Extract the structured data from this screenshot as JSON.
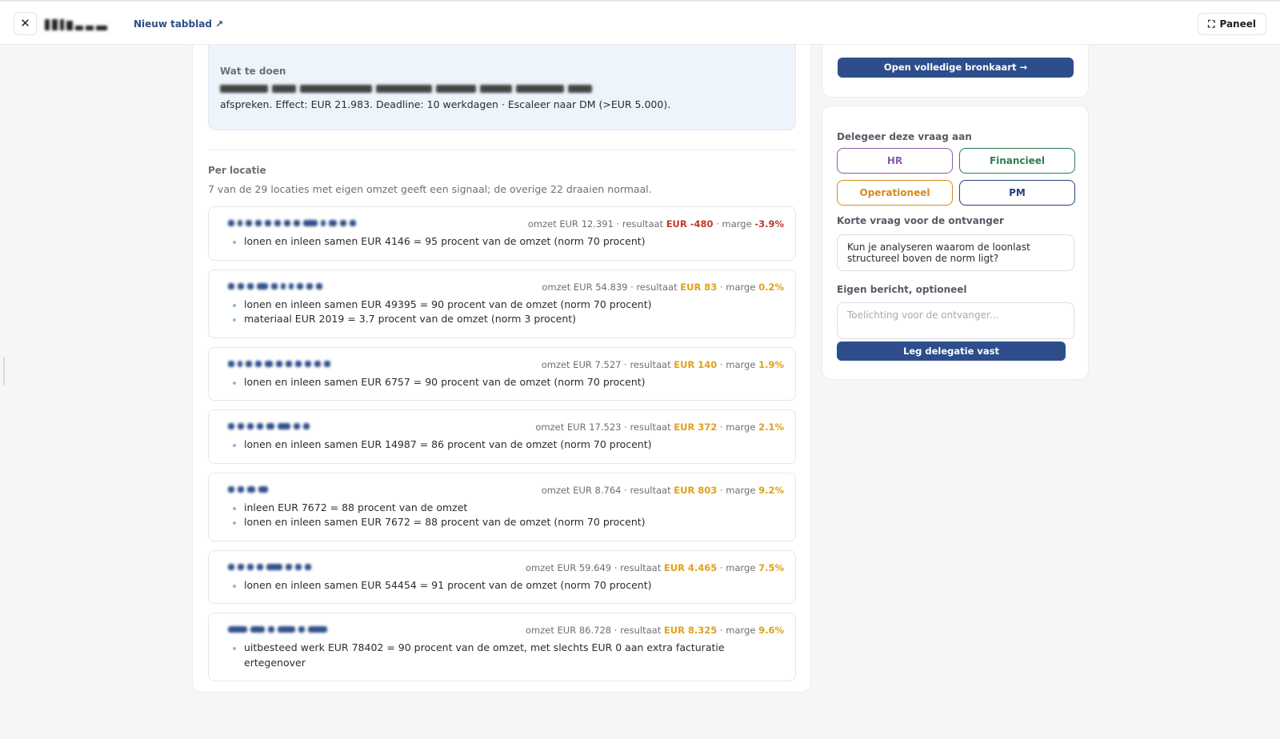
{
  "topbar": {
    "close_label": "✕",
    "new_tab_label": "Nieuw tabblad ↗",
    "panel_label": "Paneel",
    "panel_icon": "expand-icon"
  },
  "todo": {
    "heading": "Wat te doen",
    "text": "afspreken. Effect: EUR 21.983. Deadline: 10 werkdagen · Escaleer naar DM (>EUR 5.000)."
  },
  "per_locatie": {
    "heading": "Per locatie",
    "subtitle": "7 van de 29 locaties met eigen omzet geeft een signaal; de overige 22 draaien normaal.",
    "stat_labels": {
      "omzet": "omzet",
      "resultaat": "resultaat",
      "marge": "marge",
      "sep": "·"
    },
    "locations": [
      {
        "omzet": "EUR 12.391",
        "resultaat": "EUR -480",
        "marge": "-3.9%",
        "tone": "neg",
        "bullets": [
          "lonen en inleen samen EUR 4146 = 95 procent van de omzet (norm 70 procent)"
        ]
      },
      {
        "omzet": "EUR 54.839",
        "resultaat": "EUR 83",
        "marge": "0.2%",
        "tone": "pos",
        "bullets": [
          "lonen en inleen samen EUR 49395 = 90 procent van de omzet (norm 70 procent)",
          "materiaal EUR 2019 = 3.7 procent van de omzet (norm 3 procent)"
        ]
      },
      {
        "omzet": "EUR 7.527",
        "resultaat": "EUR 140",
        "marge": "1.9%",
        "tone": "pos",
        "bullets": [
          "lonen en inleen samen EUR 6757 = 90 procent van de omzet (norm 70 procent)"
        ]
      },
      {
        "omzet": "EUR 17.523",
        "resultaat": "EUR 372",
        "marge": "2.1%",
        "tone": "pos",
        "bullets": [
          "lonen en inleen samen EUR 14987 = 86 procent van de omzet (norm 70 procent)"
        ]
      },
      {
        "omzet": "EUR 8.764",
        "resultaat": "EUR 803",
        "marge": "9.2%",
        "tone": "pos",
        "bullets": [
          "inleen EUR 7672 = 88 procent van de omzet",
          "lonen en inleen samen EUR 7672 = 88 procent van de omzet (norm 70 procent)"
        ]
      },
      {
        "omzet": "EUR 59.649",
        "resultaat": "EUR 4.465",
        "marge": "7.5%",
        "tone": "pos",
        "bullets": [
          "lonen en inleen samen EUR 54454 = 91 procent van de omzet (norm 70 procent)"
        ]
      },
      {
        "omzet": "EUR 86.728",
        "resultaat": "EUR 8.325",
        "marge": "9.6%",
        "tone": "pos",
        "bullets": [
          "uitbesteed werk EUR 78402 = 90 procent van de omzet, met slechts EUR 0 aan extra facturatie ertegenover"
        ]
      }
    ]
  },
  "sidebar": {
    "source_button": "Open volledige bronkaart →",
    "delegate_heading": "Delegeer deze vraag aan",
    "departments": {
      "hr": "HR",
      "fin": "Financieel",
      "ops": "Operationeel",
      "pm": "PM"
    },
    "question_label": "Korte vraag voor de ontvanger",
    "question_value": "Kun je analyseren waarom de loonlast structureel boven de norm ligt?",
    "message_label": "Eigen bericht, optioneel",
    "message_placeholder": "Toelichting voor de ontvanger...",
    "save_button": "Leg delegatie vast"
  },
  "colors": {
    "accent": "#2d4e8a",
    "negative": "#c0392b",
    "warning": "#e0a01c",
    "hr": "#8a5ca8",
    "financieel": "#2e7d4f",
    "operationeel": "#d48a1e",
    "pm": "#24407a"
  }
}
